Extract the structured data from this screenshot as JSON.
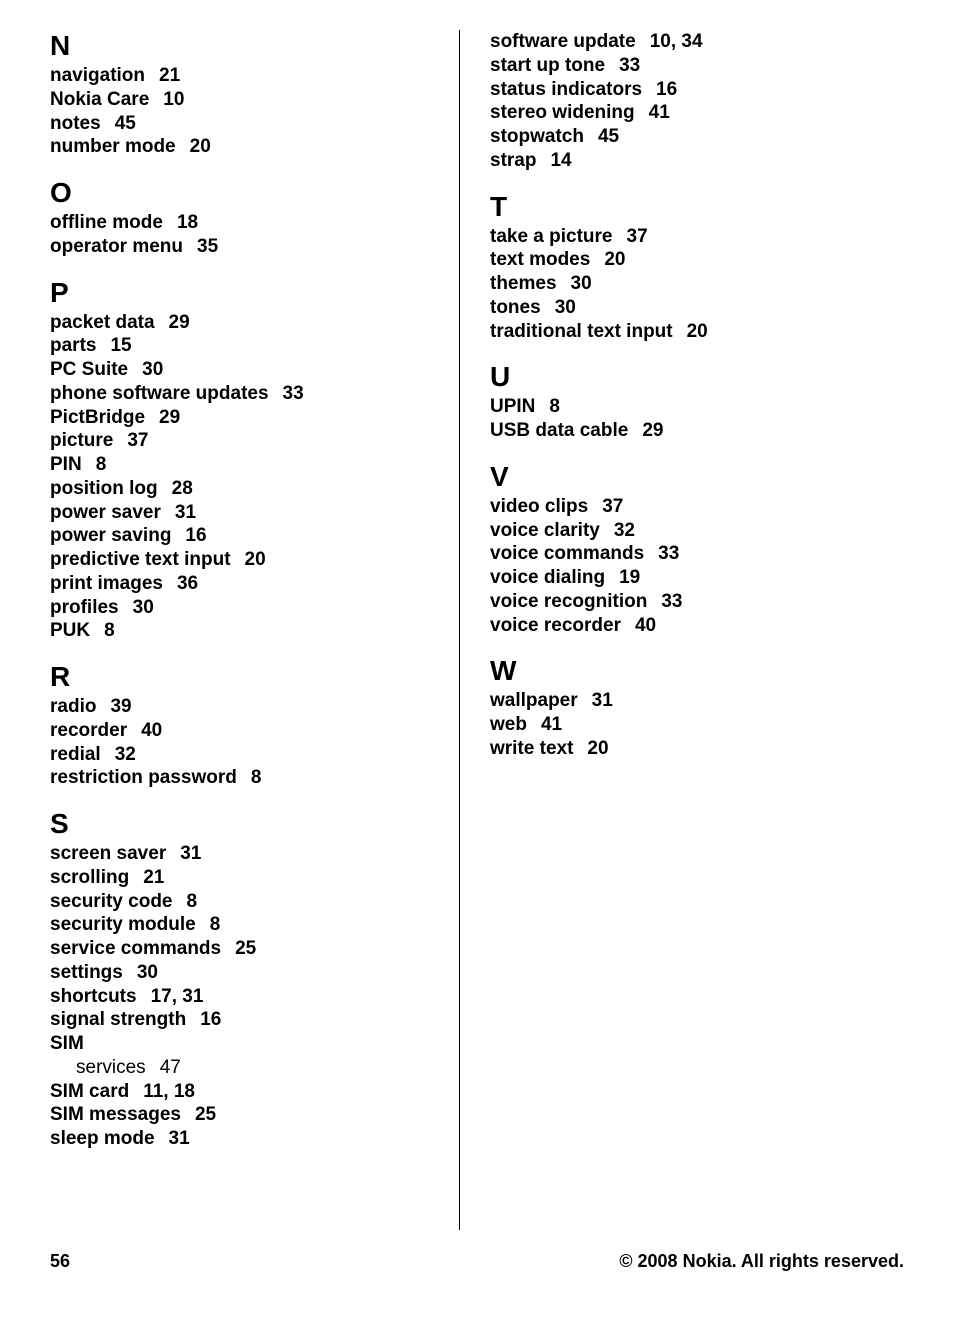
{
  "index": {
    "left": [
      {
        "type": "letter",
        "text": "N"
      },
      {
        "type": "entry",
        "term": "navigation",
        "pages": "21"
      },
      {
        "type": "entry",
        "term": "Nokia Care",
        "pages": "10"
      },
      {
        "type": "entry",
        "term": "notes",
        "pages": "45"
      },
      {
        "type": "entry",
        "term": "number mode",
        "pages": "20"
      },
      {
        "type": "letter",
        "text": "O"
      },
      {
        "type": "entry",
        "term": "offline mode",
        "pages": "18"
      },
      {
        "type": "entry",
        "term": "operator menu",
        "pages": "35"
      },
      {
        "type": "letter",
        "text": "P"
      },
      {
        "type": "entry",
        "term": "packet data",
        "pages": "29"
      },
      {
        "type": "entry",
        "term": "parts",
        "pages": "15"
      },
      {
        "type": "entry",
        "term": "PC Suite",
        "pages": "30"
      },
      {
        "type": "entry",
        "term": "phone software updates",
        "pages": "33"
      },
      {
        "type": "entry",
        "term": "PictBridge",
        "pages": "29"
      },
      {
        "type": "entry",
        "term": "picture",
        "pages": "37"
      },
      {
        "type": "entry",
        "term": "PIN",
        "pages": "8"
      },
      {
        "type": "entry",
        "term": "position log",
        "pages": "28"
      },
      {
        "type": "entry",
        "term": "power saver",
        "pages": "31"
      },
      {
        "type": "entry",
        "term": "power saving",
        "pages": "16"
      },
      {
        "type": "entry",
        "term": "predictive text input",
        "pages": "20"
      },
      {
        "type": "entry",
        "term": "print images",
        "pages": "36"
      },
      {
        "type": "entry",
        "term": "profiles",
        "pages": "30"
      },
      {
        "type": "entry",
        "term": "PUK",
        "pages": "8"
      },
      {
        "type": "letter",
        "text": "R"
      },
      {
        "type": "entry",
        "term": "radio",
        "pages": "39"
      },
      {
        "type": "entry",
        "term": "recorder",
        "pages": "40"
      },
      {
        "type": "entry",
        "term": "redial",
        "pages": "32"
      },
      {
        "type": "entry",
        "term": "restriction password",
        "pages": "8"
      },
      {
        "type": "letter",
        "text": "S"
      },
      {
        "type": "entry",
        "term": "screen saver",
        "pages": "31"
      },
      {
        "type": "entry",
        "term": "scrolling",
        "pages": "21"
      },
      {
        "type": "entry",
        "term": "security code",
        "pages": "8"
      },
      {
        "type": "entry",
        "term": "security module",
        "pages": "8"
      },
      {
        "type": "entry",
        "term": "service commands",
        "pages": "25"
      },
      {
        "type": "entry",
        "term": "settings",
        "pages": "30"
      },
      {
        "type": "entry",
        "term": "shortcuts",
        "pages": "17, 31"
      },
      {
        "type": "entry",
        "term": "signal strength",
        "pages": "16"
      },
      {
        "type": "entry",
        "term": "SIM",
        "pages": ""
      },
      {
        "type": "subentry",
        "term": "services",
        "pages": "47"
      },
      {
        "type": "entry",
        "term": "SIM card",
        "pages": "11, 18"
      },
      {
        "type": "entry",
        "term": "SIM messages",
        "pages": "25"
      },
      {
        "type": "entry",
        "term": "sleep mode",
        "pages": "31"
      }
    ],
    "right": [
      {
        "type": "entry",
        "term": "software update",
        "pages": "10, 34"
      },
      {
        "type": "entry",
        "term": "start up tone",
        "pages": "33"
      },
      {
        "type": "entry",
        "term": "status indicators",
        "pages": "16"
      },
      {
        "type": "entry",
        "term": "stereo widening",
        "pages": "41"
      },
      {
        "type": "entry",
        "term": "stopwatch",
        "pages": "45"
      },
      {
        "type": "entry",
        "term": "strap",
        "pages": "14"
      },
      {
        "type": "letter",
        "text": "T"
      },
      {
        "type": "entry",
        "term": "take a picture",
        "pages": "37"
      },
      {
        "type": "entry",
        "term": "text modes",
        "pages": "20"
      },
      {
        "type": "entry",
        "term": "themes",
        "pages": "30"
      },
      {
        "type": "entry",
        "term": "tones",
        "pages": "30"
      },
      {
        "type": "entry",
        "term": "traditional text input",
        "pages": "20"
      },
      {
        "type": "letter",
        "text": "U"
      },
      {
        "type": "entry",
        "term": "UPIN",
        "pages": "8"
      },
      {
        "type": "entry",
        "term": "USB data cable",
        "pages": "29"
      },
      {
        "type": "letter",
        "text": "V"
      },
      {
        "type": "entry",
        "term": "video clips",
        "pages": "37"
      },
      {
        "type": "entry",
        "term": "voice clarity",
        "pages": "32"
      },
      {
        "type": "entry",
        "term": "voice commands",
        "pages": "33"
      },
      {
        "type": "entry",
        "term": "voice dialing",
        "pages": "19"
      },
      {
        "type": "entry",
        "term": "voice recognition",
        "pages": "33"
      },
      {
        "type": "entry",
        "term": "voice recorder",
        "pages": "40"
      },
      {
        "type": "letter",
        "text": "W"
      },
      {
        "type": "entry",
        "term": "wallpaper",
        "pages": "31"
      },
      {
        "type": "entry",
        "term": "web",
        "pages": "41"
      },
      {
        "type": "entry",
        "term": "write text",
        "pages": "20"
      }
    ]
  },
  "footer": {
    "page_number": "56",
    "copyright": "© 2008 Nokia. All rights reserved."
  }
}
